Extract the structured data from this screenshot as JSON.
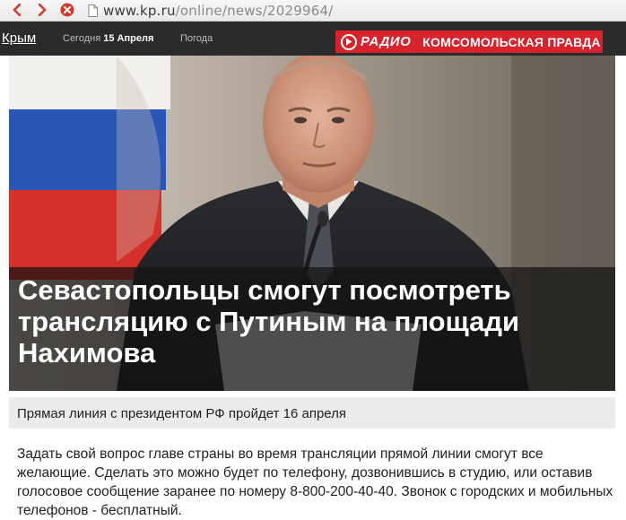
{
  "browser": {
    "url_domain": "www.kp.ru",
    "url_path": "/online/news/2029964/",
    "icons": [
      "back-arrow-icon",
      "forward-arrow-icon",
      "stop-icon",
      "page-icon"
    ]
  },
  "header": {
    "region": "Крым",
    "today_prefix": "Сегодня",
    "today_date": "15 Апреля",
    "weather": "Погода",
    "radio_word": "РАДИО",
    "radio_brand": "КОМСОМОЛЬСКАЯ ПРАВДА",
    "accent_color": "#d9232c"
  },
  "article": {
    "headline": "Севастопольцы смогут посмотреть трансляцию с Путиным на площади Нахимова",
    "subtitle": "Прямая линия с президентом РФ пройдет 16 апреля",
    "body": "Задать свой вопрос главе страны во время трансляции прямой линии смогут все желающие. Сделать это можно будет по телефону, дозвонившись в студию, или оставив голосовое сообщение заранее по номеру 8-800-200-40-40. Звонок с городских и мобильных телефонов - бесплатный."
  }
}
